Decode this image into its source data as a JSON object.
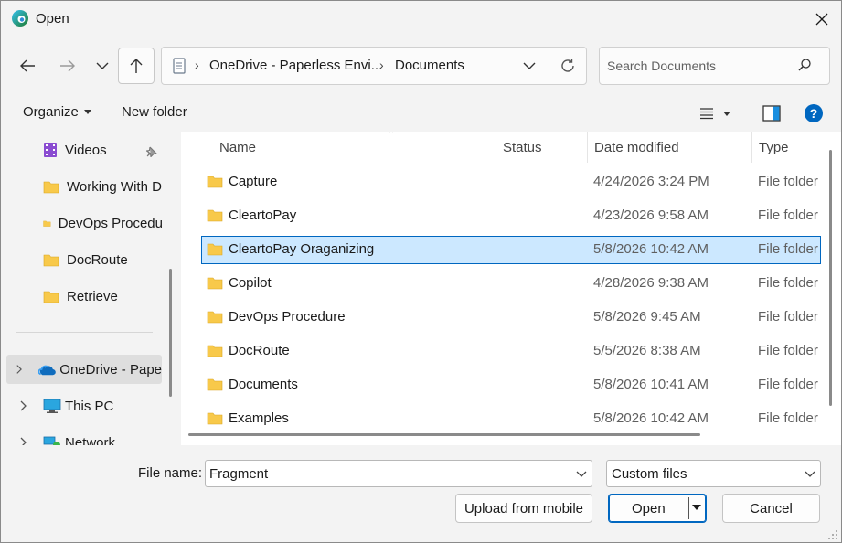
{
  "window": {
    "title": "Open"
  },
  "address": {
    "segments": [
      "OneDrive - Paperless Envi...",
      "Documents"
    ]
  },
  "search": {
    "placeholder": "Search Documents"
  },
  "toolbar": {
    "organize": "Organize",
    "new_folder": "New folder"
  },
  "nav_pane": {
    "items": [
      {
        "label": "Videos"
      },
      {
        "label": "Working With D"
      },
      {
        "label": "DevOps Procedu"
      },
      {
        "label": "DocRoute"
      },
      {
        "label": "Retrieve"
      },
      {
        "label": "OneDrive - Pape"
      },
      {
        "label": "This PC"
      },
      {
        "label": "Network"
      }
    ]
  },
  "columns": {
    "name": "Name",
    "status": "Status",
    "date": "Date modified",
    "type": "Type"
  },
  "files": [
    {
      "name": "Capture",
      "date": "4/24/2026 3:24 PM",
      "type": "File folder"
    },
    {
      "name": "CleartoPay",
      "date": "4/23/2026 9:58 AM",
      "type": "File folder"
    },
    {
      "name": "CleartoPay Oraganizing",
      "date": "5/8/2026 10:42 AM",
      "type": "File folder"
    },
    {
      "name": "Copilot",
      "date": "4/28/2026 9:38 AM",
      "type": "File folder"
    },
    {
      "name": "DevOps Procedure",
      "date": "5/8/2026 9:45 AM",
      "type": "File folder"
    },
    {
      "name": "DocRoute",
      "date": "5/5/2026 8:38 AM",
      "type": "File folder"
    },
    {
      "name": "Documents",
      "date": "5/8/2026 10:41 AM",
      "type": "File folder"
    },
    {
      "name": "Examples",
      "date": "5/8/2026 10:42 AM",
      "type": "File folder"
    }
  ],
  "bottom": {
    "file_name_label": "File name:",
    "file_name_value": "Fragment",
    "filter": "Custom files",
    "upload": "Upload from mobile",
    "open": "Open",
    "cancel": "Cancel"
  },
  "colors": {
    "accent": "#0067c0",
    "selection": "#cce8ff",
    "folder": "#f8c94a"
  }
}
